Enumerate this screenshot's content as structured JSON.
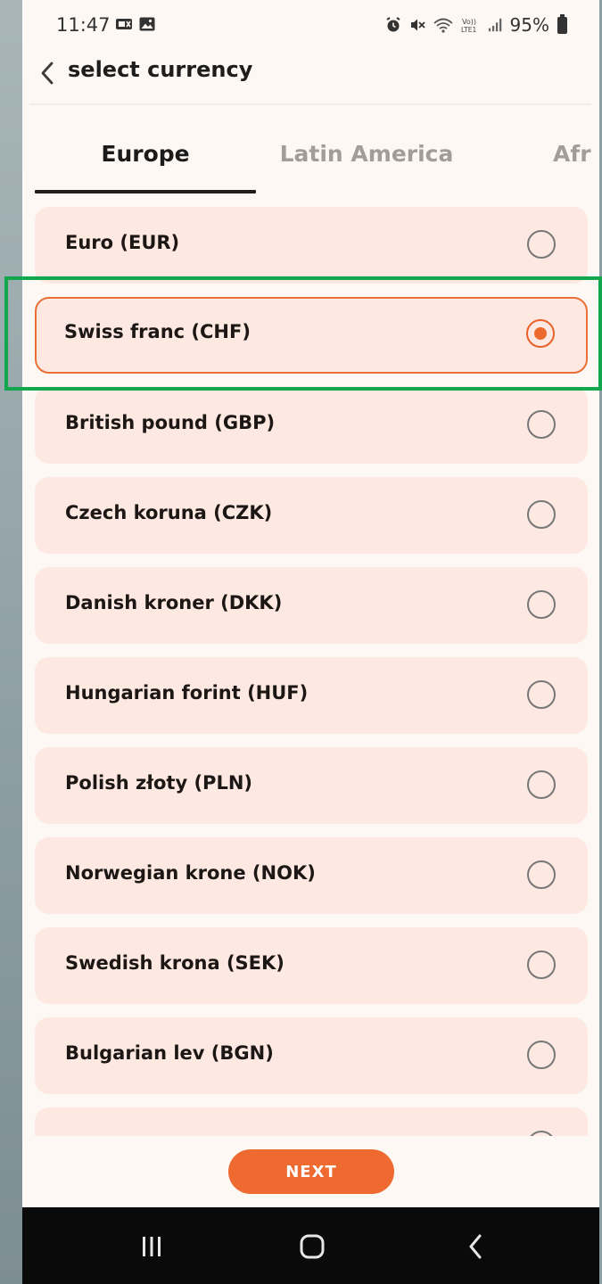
{
  "status_bar": {
    "time": "11:47",
    "battery": "95%",
    "notif_icons": [
      "sim-icon",
      "image-icon"
    ],
    "system_icons": [
      "alarm-icon",
      "mute-icon",
      "wifi-icon",
      "volte-icon",
      "signal-icon",
      "battery-icon"
    ]
  },
  "header": {
    "title": "select currency",
    "back_icon": "chevron-left-icon"
  },
  "tabs": [
    {
      "label": "Europe",
      "active": true
    },
    {
      "label": "Latin America",
      "active": false
    },
    {
      "label": "Afr",
      "active": false
    }
  ],
  "currencies": [
    {
      "label": "Euro (EUR)",
      "selected": false
    },
    {
      "label": "Swiss franc (CHF)",
      "selected": true
    },
    {
      "label": "British pound (GBP)",
      "selected": false
    },
    {
      "label": "Czech koruna (CZK)",
      "selected": false
    },
    {
      "label": "Danish kroner (DKK)",
      "selected": false
    },
    {
      "label": "Hungarian forint (HUF)",
      "selected": false
    },
    {
      "label": "Polish złoty (PLN)",
      "selected": false
    },
    {
      "label": "Norwegian krone (NOK)",
      "selected": false
    },
    {
      "label": "Swedish krona (SEK)",
      "selected": false
    },
    {
      "label": "Bulgarian lev (BGN)",
      "selected": false
    }
  ],
  "next_button": {
    "label": "NEXT"
  },
  "nav_bar": {
    "icons": [
      "recents-icon",
      "home-icon",
      "back-icon"
    ]
  },
  "colors": {
    "accent": "#ee6a30",
    "item_bg": "#fde9e1",
    "highlight": "#12a64d"
  }
}
